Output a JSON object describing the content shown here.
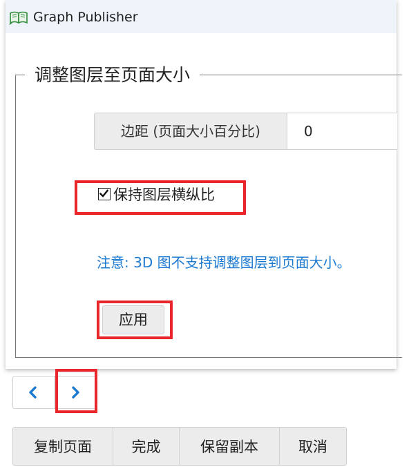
{
  "window": {
    "title": "Graph Publisher",
    "icon": "open-book-icon"
  },
  "group": {
    "title": "调整图层至页面大小"
  },
  "margin": {
    "label": "边距 (页面大小百分比)",
    "value": "0"
  },
  "keep_aspect": {
    "label": "保持图层横纵比",
    "checked": true
  },
  "note": "注意: 3D 图不支持调整图层到页面大小。",
  "apply_label": "应用",
  "pager": {
    "prev_icon": "chevron-left-icon",
    "next_icon": "chevron-right-icon"
  },
  "actions": {
    "copy_page": "复制页面",
    "done": "完成",
    "keep_copy": "保留副本",
    "cancel": "取消"
  },
  "colors": {
    "highlight": "#e8262b",
    "note_text": "#1d7ad1",
    "pager_arrow": "#1d7ad1",
    "titlebar": "#eef4fa"
  }
}
